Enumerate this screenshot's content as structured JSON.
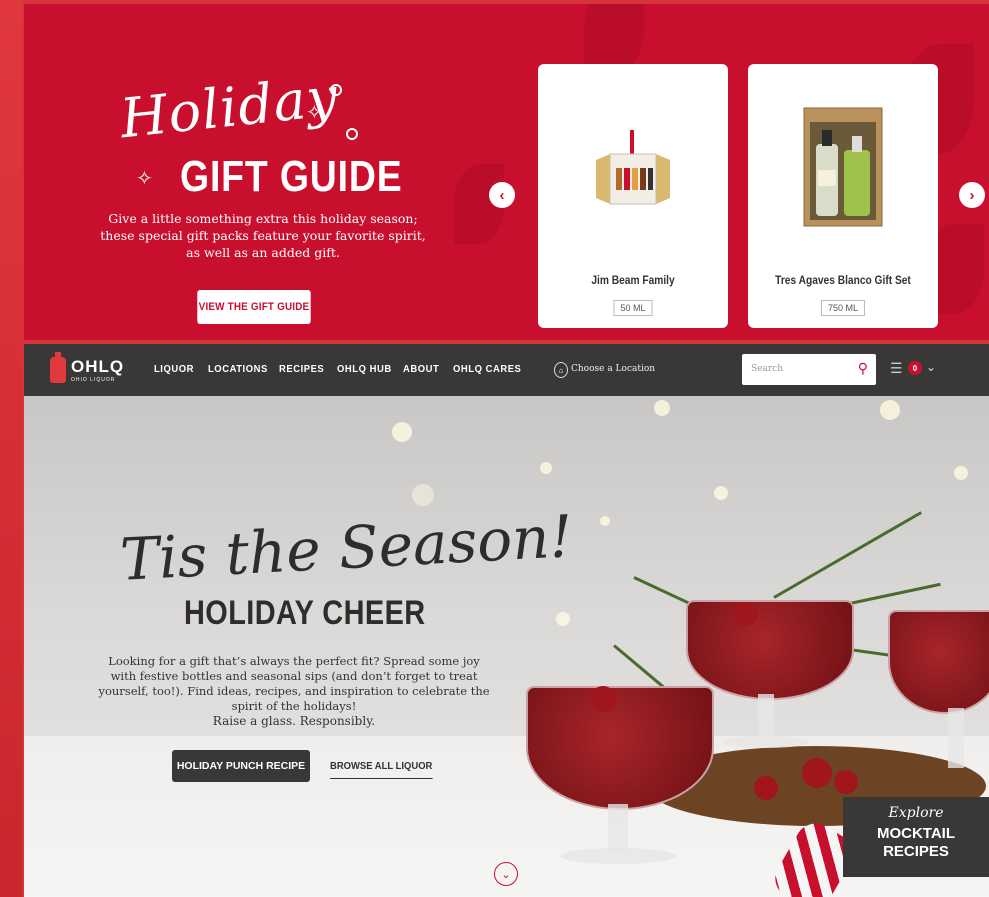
{
  "banner": {
    "script_title": "Holiday",
    "title": "GIFT GUIDE",
    "description": "Give a little something extra this holiday season; these special gift packs feature your favorite spirit, as well as an added gift.",
    "button_label": "VIEW THE GIFT GUIDE",
    "products": [
      {
        "name": "Jim Beam Family",
        "size": "50 ML"
      },
      {
        "name": "Tres Agaves Blanco Gift Set",
        "size": "750 ML"
      }
    ]
  },
  "nav": {
    "logo": "OHLQ",
    "logo_sub": "OHIO LIQUOR",
    "links": [
      "LIQUOR",
      "LOCATIONS",
      "RECIPES",
      "OHLQ HUB",
      "ABOUT",
      "OHLQ CARES"
    ],
    "location_label": "Choose a Location",
    "search_placeholder": "Search",
    "cart_count": "0"
  },
  "hero": {
    "script_title": "Tis the Season!",
    "title": "HOLIDAY CHEER",
    "description": "Looking for a gift that’s always the perfect fit? Spread some joy with festive bottles and seasonal sips (and don’t forget to treat yourself, too!). Find ideas, recipes, and inspiration to celebrate the spirit of the holidays!",
    "tagline": "Raise a glass. Responsibly.",
    "primary_button": "HOLIDAY PUNCH RECIPE",
    "secondary_link": "BROWSE ALL LIQUOR",
    "mocktail_explore": "Explore",
    "mocktail_title": "MOCKTAIL RECIPES"
  },
  "colors": {
    "brand_red": "#c8102e",
    "dark": "#3a3836"
  }
}
